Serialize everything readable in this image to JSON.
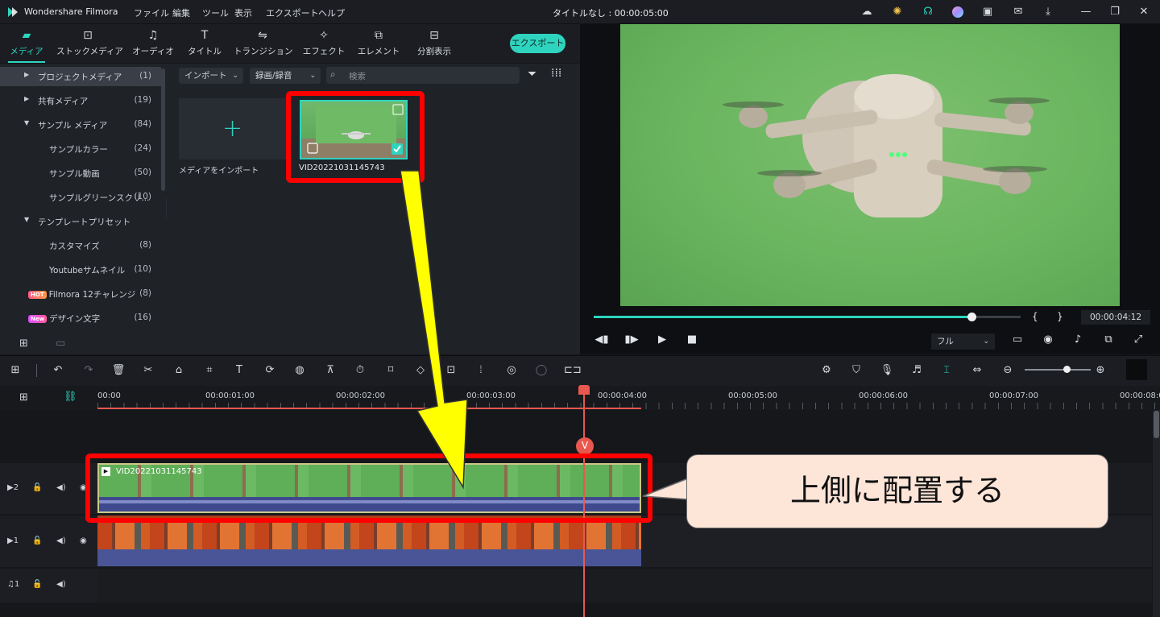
{
  "window": {
    "app_name": "Wondershare Filmora",
    "document_title": "タイトルなし : 00:00:05:00",
    "menus": [
      "ファイル",
      "編集",
      "ツール",
      "表示",
      "エクスポート",
      "ヘルプ"
    ]
  },
  "toolbar": {
    "tabs": [
      {
        "label": "メディア",
        "icon": "folder-icon",
        "active": true
      },
      {
        "label": "ストックメディア",
        "icon": "stock-media-icon"
      },
      {
        "label": "オーディオ",
        "icon": "music-note-icon"
      },
      {
        "label": "タイトル",
        "icon": "text-t-icon"
      },
      {
        "label": "トランジション",
        "icon": "transition-icon"
      },
      {
        "label": "エフェクト",
        "icon": "effects-sparkle-icon"
      },
      {
        "label": "エレメント",
        "icon": "elements-icon"
      },
      {
        "label": "分割表示",
        "icon": "split-screen-icon"
      }
    ],
    "export_label": "エクスポート"
  },
  "sidebar": {
    "items": [
      {
        "label": "プロジェクトメディア",
        "count": "(1)",
        "arrow": "▶"
      },
      {
        "label": "共有メディア",
        "count": "(19)",
        "arrow": "▶"
      },
      {
        "label": "サンプル メディア",
        "count": "(84)",
        "arrow": "▼"
      },
      {
        "label": "サンプルカラー",
        "count": "(24)"
      },
      {
        "label": "サンプル動画",
        "count": "(50)"
      },
      {
        "label": "サンプルグリーンスクリ...",
        "count": "(10)"
      },
      {
        "label": "テンプレートプリセット",
        "count": "",
        "arrow": "▼"
      },
      {
        "label": "カスタマイズ",
        "count": "(8)"
      },
      {
        "label": "Youtubeサムネイル",
        "count": "(10)"
      },
      {
        "label": "Filmora 12チャレンジ",
        "count": "(8)",
        "badge": "HOT"
      },
      {
        "label": "デザイン文字",
        "count": "(16)",
        "badge": "New"
      }
    ]
  },
  "media": {
    "import_dropdown": "インポート",
    "record_dropdown": "録画/録音",
    "search_placeholder": "検索",
    "import_tile_label": "メディアをインポート",
    "clip_name": "VID20221031145743"
  },
  "preview": {
    "timecode": "00:00:04:12",
    "quality": "フル",
    "progress": 0.885,
    "mark_in": "{",
    "mark_out": "}"
  },
  "timeline": {
    "ruler_labels": [
      "00:00",
      "00:00:01:00",
      "00:00:02:00",
      "00:00:03:00",
      "00:00:04:00",
      "00:00:05:00",
      "00:00:06:00",
      "00:00:07:00",
      "00:00:08:0"
    ],
    "playhead_marker": "V",
    "tracks": [
      {
        "icon": "video-track-icon",
        "number": "2"
      },
      {
        "icon": "video-track-icon",
        "number": "1"
      },
      {
        "icon": "audio-track-icon",
        "number": "1"
      }
    ],
    "clip_v2_label": "VID20221031145743"
  },
  "annotation": {
    "callout_text": "上側に配置する",
    "highlight_color": "#ff0000",
    "arrow_color": "#ffff00"
  },
  "colors": {
    "accent": "#2fd4bf",
    "playhead": "#e8584e"
  }
}
